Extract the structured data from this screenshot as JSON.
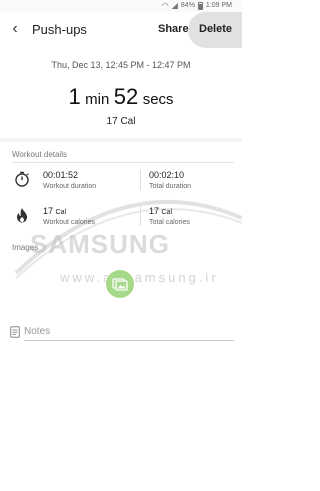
{
  "status_bar": {
    "battery": "84%",
    "time": "1:09 PM"
  },
  "app_bar": {
    "title": "Push-ups",
    "share_label": "Share",
    "delete_label": "Delete"
  },
  "summary": {
    "date_range": "Thu, Dec 13, 12:45 PM - 12:47 PM",
    "minutes": "1",
    "minutes_unit": "min",
    "seconds": "52",
    "seconds_unit": "secs",
    "calories": "17 Cal"
  },
  "workout_details": {
    "title": "Workout details",
    "workout_duration": {
      "value": "00:01:52",
      "label": "Workout duration"
    },
    "total_duration": {
      "value": "00:02:10",
      "label": "Total duration"
    },
    "workout_calories": {
      "value": "17",
      "unit": "Cal",
      "label": "Workout calories"
    },
    "total_calories": {
      "value": "17",
      "unit": "Cal",
      "label": "Total calories"
    }
  },
  "images": {
    "title": "Images"
  },
  "notes": {
    "placeholder": "Notes"
  },
  "watermark": {
    "text": "SAMSUNG",
    "url": "www.allsamsung.ir"
  },
  "colors": {
    "accent_green": "#a6d98a",
    "delete_bg": "#e1e1e1"
  }
}
